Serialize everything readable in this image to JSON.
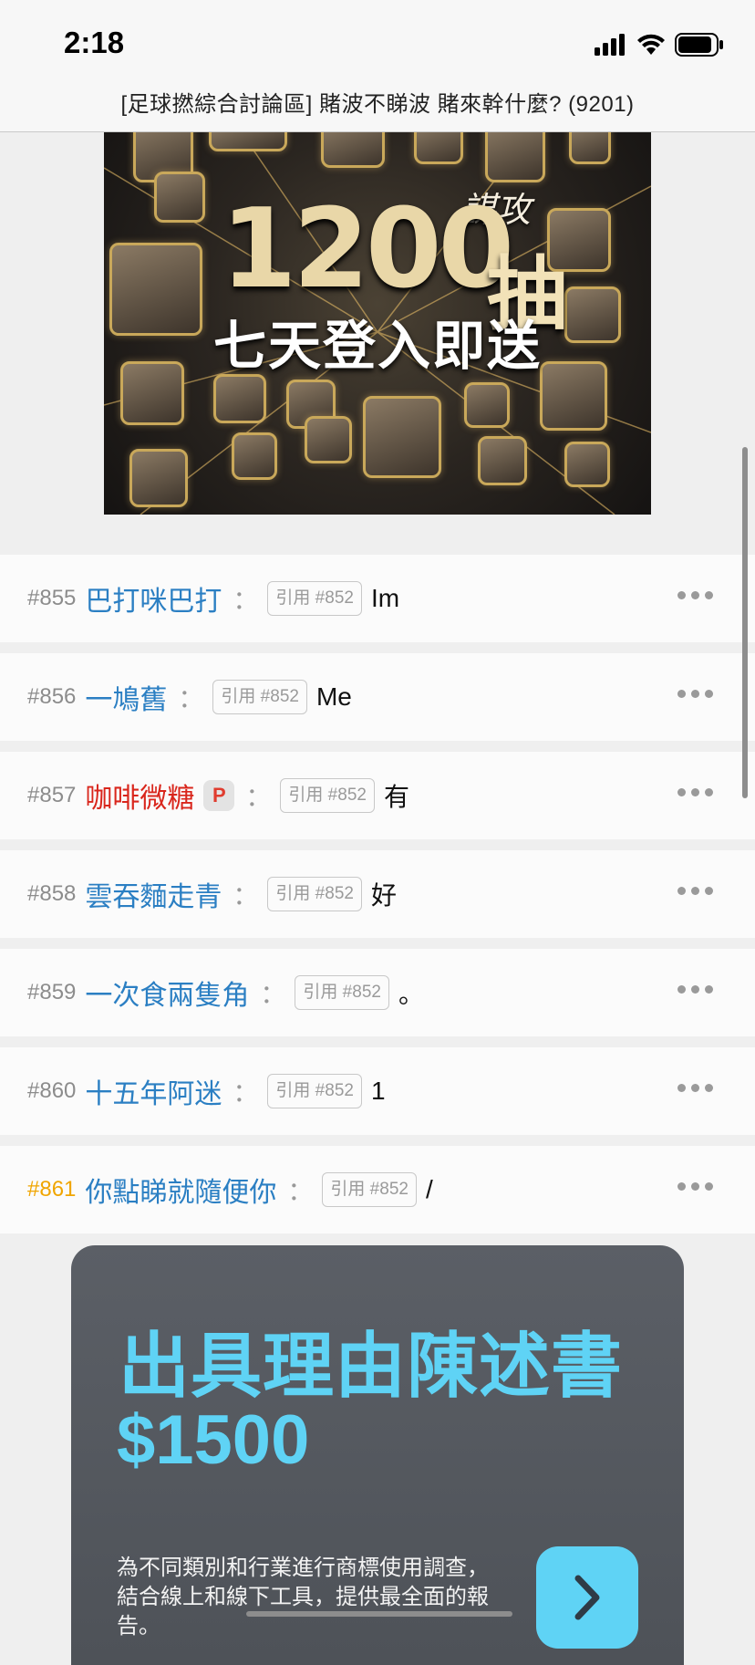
{
  "status_bar": {
    "time": "2:18"
  },
  "header": {
    "title": "[足球撚綜合討論區] 賭波不睇波 賭來幹什麼? (9201)"
  },
  "top_ad": {
    "headline_number": "1200",
    "headline_char": "抽",
    "logo_text": "謀攻",
    "subtitle": "七天登入即送"
  },
  "replies": [
    {
      "floor": "#855",
      "author": "巴打咪巴打",
      "quote": "引用 #852",
      "message": "Im",
      "author_color": "blue",
      "premium": false
    },
    {
      "floor": "#856",
      "author": "一鳩舊",
      "quote": "引用 #852",
      "message": "Me",
      "author_color": "blue",
      "premium": false
    },
    {
      "floor": "#857",
      "author": "咖啡微糖",
      "quote": "引用 #852",
      "message": "有",
      "author_color": "red",
      "premium": true,
      "premium_label": "P"
    },
    {
      "floor": "#858",
      "author": "雲吞麵走青",
      "quote": "引用 #852",
      "message": "好",
      "author_color": "blue",
      "premium": false
    },
    {
      "floor": "#859",
      "author": "一次食兩隻角",
      "quote": "引用 #852",
      "message": "。",
      "author_color": "blue",
      "premium": false
    },
    {
      "floor": "#860",
      "author": "十五年阿迷",
      "quote": "引用 #852",
      "message": "1",
      "author_color": "blue",
      "premium": false
    },
    {
      "floor": "#861",
      "author": "你點睇就隨便你",
      "quote": "引用 #852",
      "message": "/",
      "author_color": "blue",
      "premium": false,
      "highlight_floor": true
    }
  ],
  "bottom_ad": {
    "title": "出具理由陳述書",
    "price": "$1500",
    "description": "為不同類別和行業進行商標使用調查，結合線上和線下工具，提供最全面的報告。",
    "button_icon": "chevron-right-icon"
  },
  "colors": {
    "link_blue": "#2b7fc3",
    "premium_red": "#d9261c",
    "latest_floor": "#f0a500",
    "ad_accent": "#5fd3f5"
  }
}
